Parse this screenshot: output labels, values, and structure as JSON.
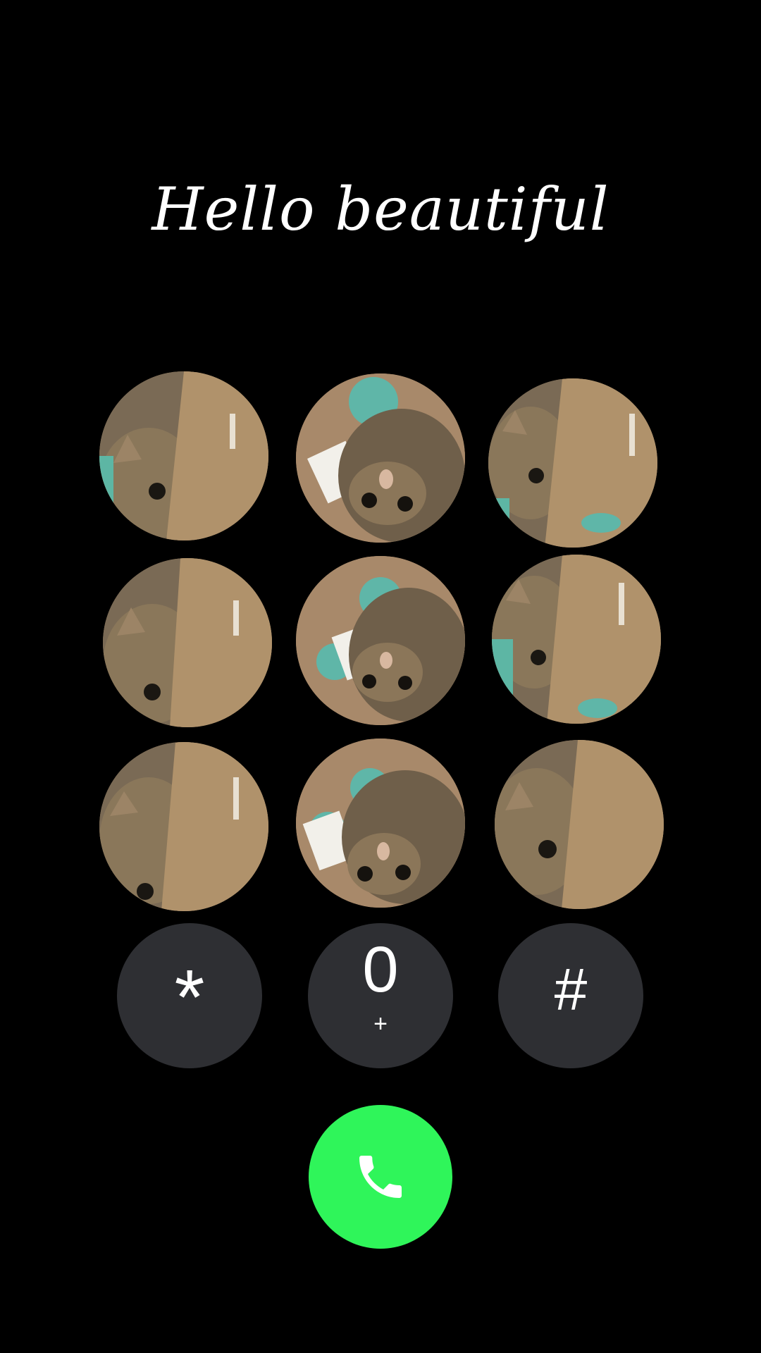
{
  "greeting": "Hello beautiful",
  "keypad": {
    "tiles": [
      {
        "row": 0,
        "col": 0,
        "photo": "cat-peeking-behind-box"
      },
      {
        "row": 0,
        "col": 1,
        "photo": "cat-lying-in-box"
      },
      {
        "row": 0,
        "col": 2,
        "photo": "cat-peeking-behind-box"
      },
      {
        "row": 1,
        "col": 0,
        "photo": "cat-peeking-behind-box"
      },
      {
        "row": 1,
        "col": 1,
        "photo": "cat-lying-in-box"
      },
      {
        "row": 1,
        "col": 2,
        "photo": "cat-peeking-behind-box"
      },
      {
        "row": 2,
        "col": 0,
        "photo": "cat-peeking-behind-box"
      },
      {
        "row": 2,
        "col": 1,
        "photo": "cat-lying-in-box"
      },
      {
        "row": 2,
        "col": 2,
        "photo": "cat-peeking-behind-box"
      }
    ],
    "star_key": "*",
    "zero_key": "0",
    "zero_sub": "+",
    "hash_key": "#"
  },
  "call_button": {
    "icon": "phone-icon",
    "color": "#2ff55a"
  },
  "colors": {
    "background": "#000000",
    "key_background": "#2e2f33",
    "cardboard": "#a4865e",
    "cat_fur": "#7d6a50"
  }
}
